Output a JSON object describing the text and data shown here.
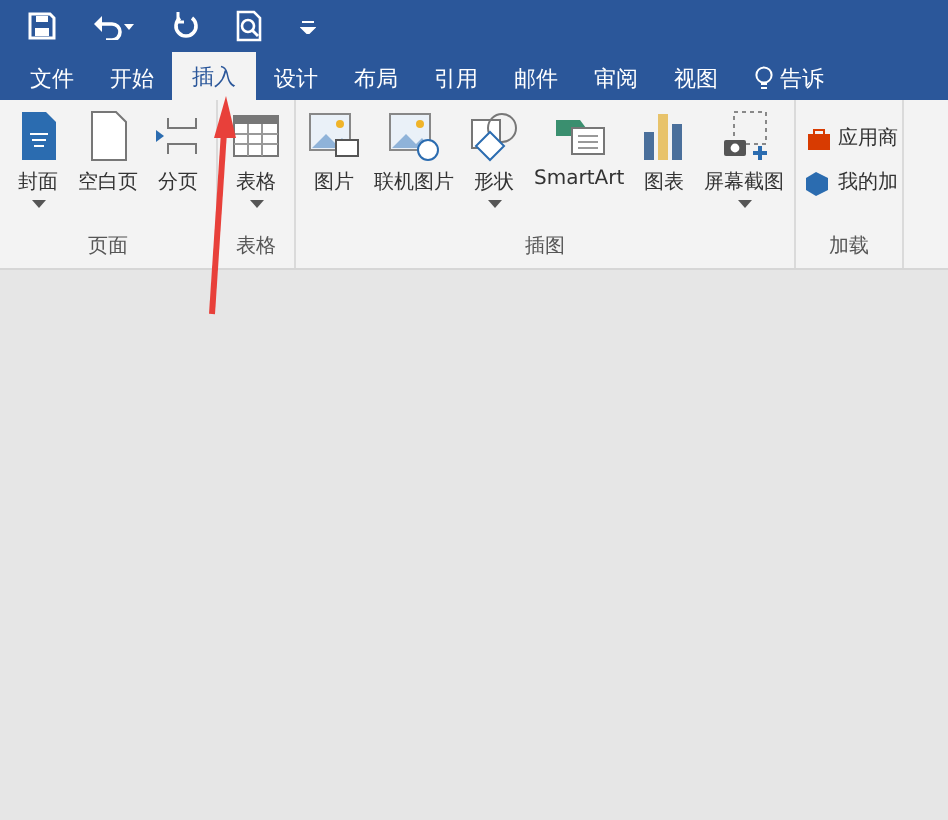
{
  "tabs": [
    {
      "label": "文件",
      "selected": false
    },
    {
      "label": "开始",
      "selected": false
    },
    {
      "label": "插入",
      "selected": true
    },
    {
      "label": "设计",
      "selected": false
    },
    {
      "label": "布局",
      "selected": false
    },
    {
      "label": "引用",
      "selected": false
    },
    {
      "label": "邮件",
      "selected": false
    },
    {
      "label": "审阅",
      "selected": false
    },
    {
      "label": "视图",
      "selected": false
    },
    {
      "label": "告诉",
      "selected": false,
      "kind": "search"
    }
  ],
  "groups": [
    {
      "label": "页面",
      "buttons": [
        {
          "label": "封面",
          "dropdown": true
        },
        {
          "label": "空白页",
          "dropdown": false
        },
        {
          "label": "分页",
          "dropdown": false
        }
      ]
    },
    {
      "label": "表格",
      "buttons": [
        {
          "label": "表格",
          "dropdown": true
        }
      ]
    },
    {
      "label": "插图",
      "buttons": [
        {
          "label": "图片",
          "dropdown": false
        },
        {
          "label": "联机图片",
          "dropdown": false
        },
        {
          "label": "形状",
          "dropdown": true
        },
        {
          "label": "SmartArt",
          "dropdown": false
        },
        {
          "label": "图表",
          "dropdown": false
        },
        {
          "label": "屏幕截图",
          "dropdown": true
        }
      ]
    },
    {
      "label": "加载",
      "kind": "small",
      "buttons": [
        {
          "label": "应用商",
          "dropdown": false
        },
        {
          "label": "我的加",
          "dropdown": false
        }
      ]
    }
  ]
}
